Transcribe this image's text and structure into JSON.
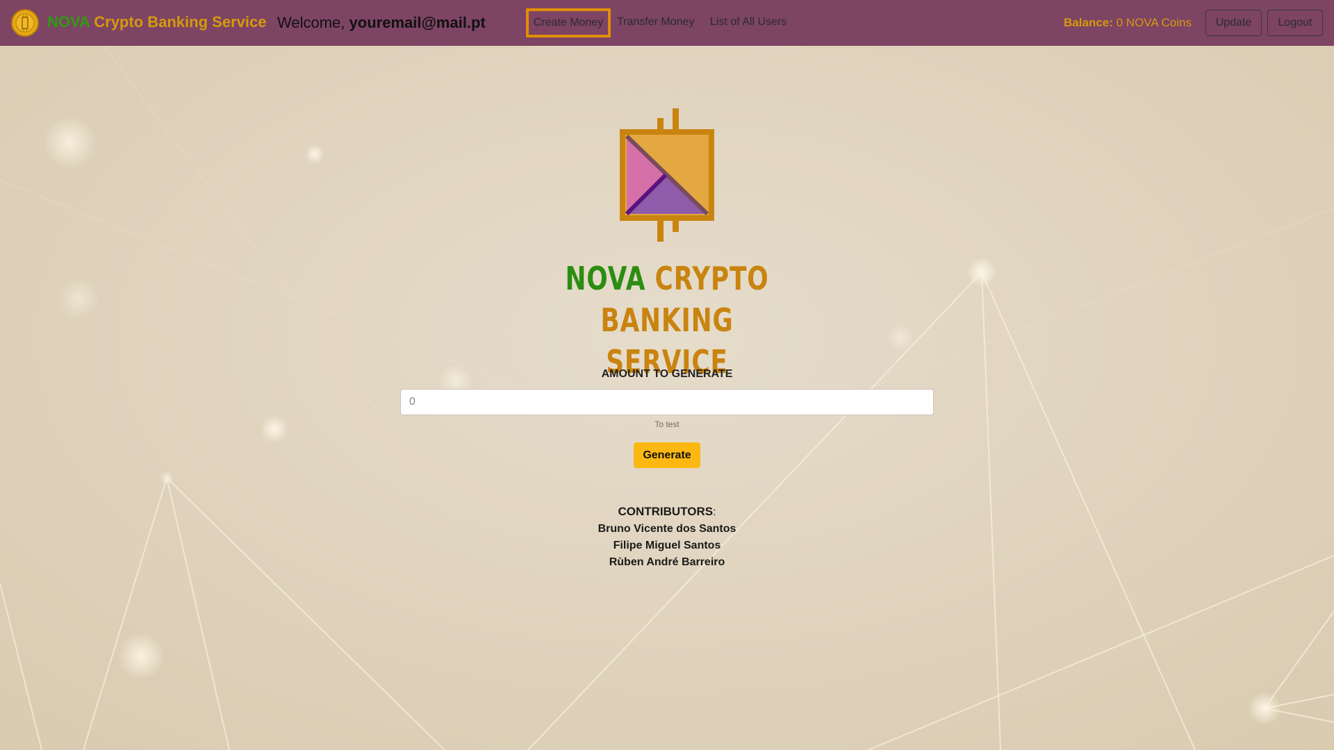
{
  "brand": {
    "name_highlight": "NOVA",
    "name_rest": "Crypto Banking Service",
    "coin_icon": "coin-icon"
  },
  "header": {
    "welcome_prefix": "Welcome,",
    "user_email": "youremail@mail.pt",
    "nav": [
      {
        "label": "Create Money",
        "active": true
      },
      {
        "label": "Transfer Money",
        "active": false
      },
      {
        "label": "List of All Users",
        "active": false
      }
    ],
    "balance_label": "Balance:",
    "balance_value": "0 NOVA Coins",
    "update_label": "Update",
    "logout_label": "Logout"
  },
  "logo": {
    "title_highlight": "NOVA",
    "title_line1_rest": "CRYPTO",
    "title_line2": "BANKING SERVICE",
    "icon": "nova-bitcoin-logo-icon"
  },
  "form": {
    "label": "AMOUNT TO GENERATE",
    "placeholder": "0",
    "hint": "To test",
    "submit_label": "Generate"
  },
  "contributors": {
    "heading": "CONTRIBUTORS",
    "separator": ":",
    "names": [
      "Bruno Vicente dos Santos",
      "Filipe Miguel Santos",
      "Rùben André Barreiro"
    ]
  },
  "colors": {
    "navbar": "#7d4464",
    "accent_gold": "#d59a0c",
    "nova_green": "#2f9a12",
    "generate_button": "#fcb812",
    "active_border": "#e18e06",
    "background": "#e4d9c5"
  }
}
